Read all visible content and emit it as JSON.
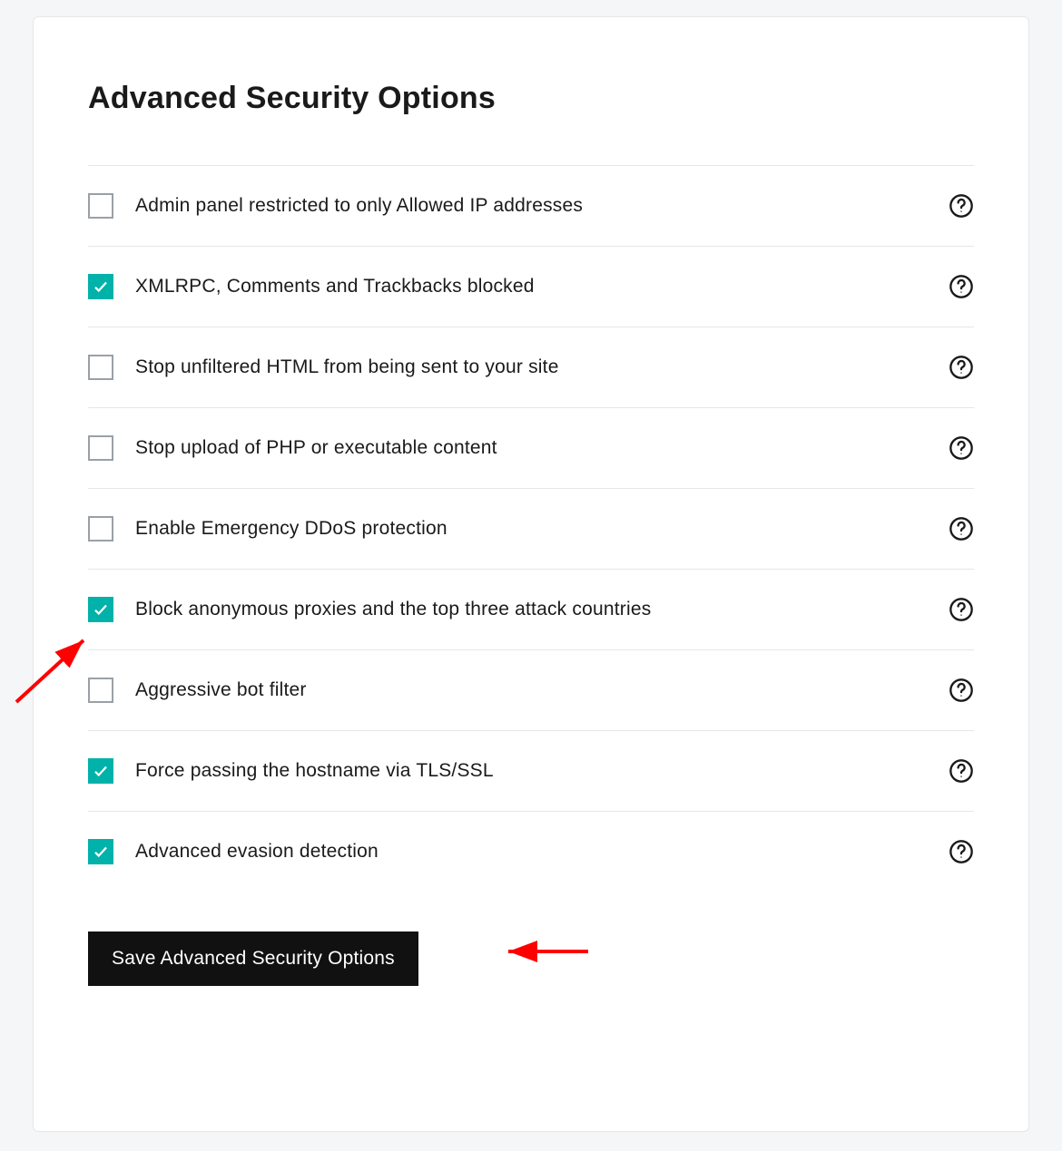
{
  "heading": "Advanced Security Options",
  "options": [
    {
      "id": "restrict-admin-ip",
      "label": "Admin panel restricted to only Allowed IP addresses",
      "checked": false
    },
    {
      "id": "block-xmlrpc",
      "label": "XMLRPC, Comments and Trackbacks blocked",
      "checked": true
    },
    {
      "id": "stop-unfiltered-html",
      "label": "Stop unfiltered HTML from being sent to your site",
      "checked": false
    },
    {
      "id": "stop-upload-exec",
      "label": "Stop upload of PHP or executable content",
      "checked": false
    },
    {
      "id": "emergency-ddos",
      "label": "Enable Emergency DDoS protection",
      "checked": false
    },
    {
      "id": "block-anon-proxies",
      "label": "Block anonymous proxies and the top three attack countries",
      "checked": true
    },
    {
      "id": "aggressive-bot-filter",
      "label": "Aggressive bot filter",
      "checked": false
    },
    {
      "id": "force-hostname-tls",
      "label": "Force passing the hostname via TLS/SSL",
      "checked": true
    },
    {
      "id": "advanced-evasion",
      "label": "Advanced evasion detection",
      "checked": true
    }
  ],
  "save_button_label": "Save Advanced Security Options",
  "colors": {
    "accent": "#00b2a9",
    "annotation": "#ff0000"
  }
}
